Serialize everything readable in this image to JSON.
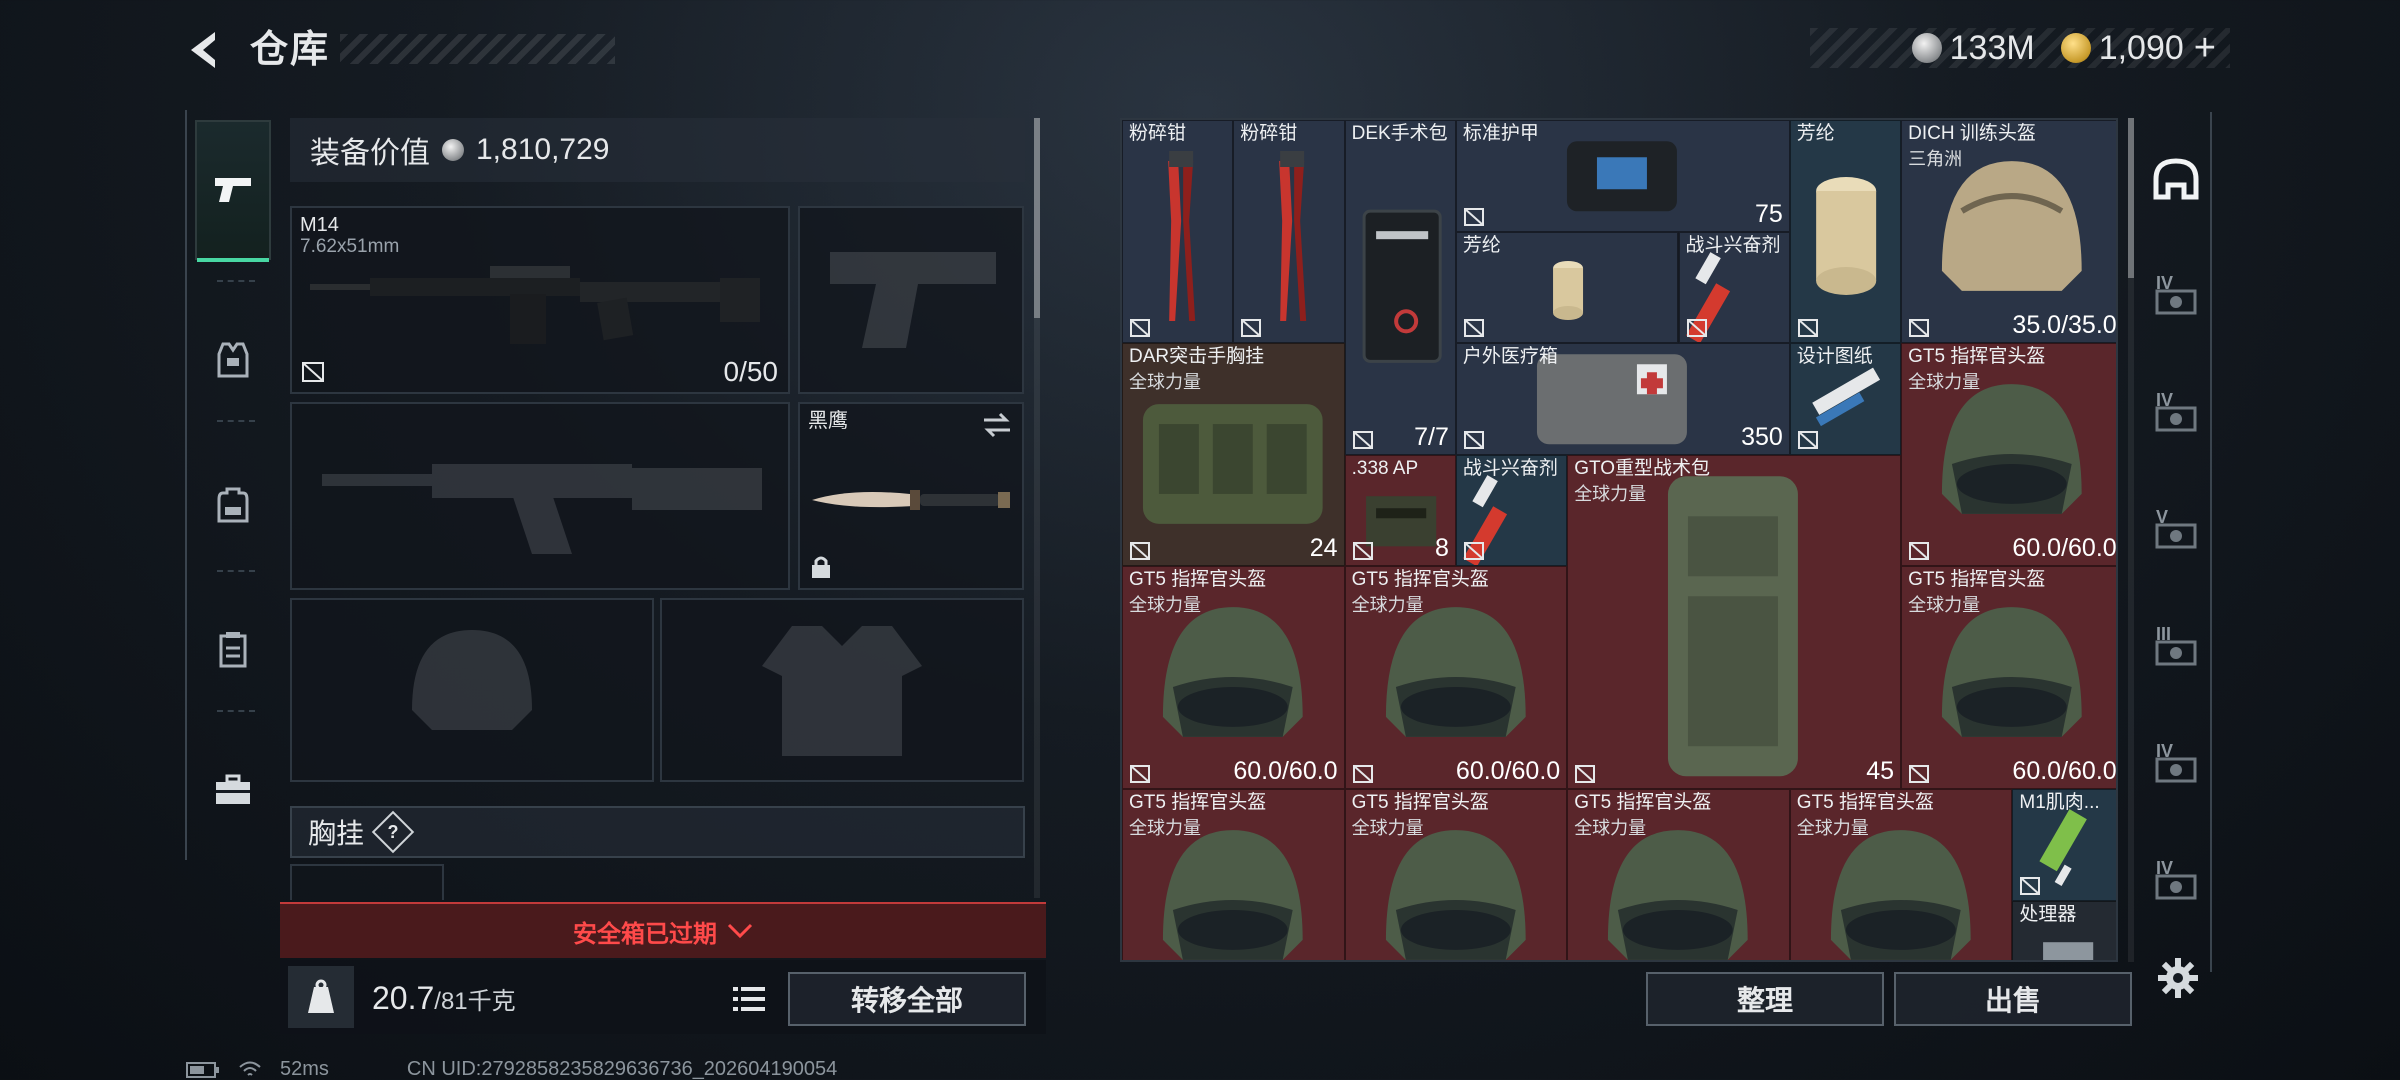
{
  "header": {
    "title": "仓库",
    "currency": [
      {
        "icon": "silver-coin-icon",
        "value": "133M"
      },
      {
        "icon": "gold-coin-icon",
        "value": "1,090"
      }
    ],
    "add_symbol": "+"
  },
  "left_rail": {
    "items": [
      {
        "icon": "pistol-icon",
        "active": true
      },
      {
        "icon": "vest-icon",
        "active": false
      },
      {
        "icon": "backpack-icon",
        "active": false
      },
      {
        "icon": "case-icon",
        "active": false
      },
      {
        "icon": "briefcase-icon",
        "active": false
      }
    ]
  },
  "equipment": {
    "value_label": "装备价值",
    "value": "1,810,729",
    "primary": {
      "name": "M14",
      "caliber": "7.62x51mm",
      "ammo": "0/50"
    },
    "melee": {
      "name": "黑鹰"
    },
    "chest_label": "胸挂",
    "chest_help": "?",
    "safebox_text": "安全箱已过期",
    "weight_current": "20.7",
    "weight_max": "/81千克",
    "transfer_all": "转移全部"
  },
  "inventory": {
    "items": [
      {
        "name": "粉碎钳",
        "sub": "",
        "value": "",
        "color": "blue",
        "art": "pliers"
      },
      {
        "name": "粉碎钳",
        "sub": "",
        "value": "",
        "color": "blue",
        "art": "pliers"
      },
      {
        "name": "DEK手术包",
        "sub": "",
        "value": "7/7",
        "color": "blue",
        "art": "surgical-kit"
      },
      {
        "name": "标准护甲",
        "sub": "",
        "value": "75",
        "color": "blue",
        "art": "armor-bag"
      },
      {
        "name": "芳纶",
        "sub": "",
        "value": "",
        "color": "teal",
        "art": "fabric-roll"
      },
      {
        "name": "DICH 训练头盔",
        "sub": "三角洲",
        "value": "35.0/35.0",
        "color": "blue",
        "art": "helmet-tan"
      },
      {
        "name": "芳纶",
        "sub": "",
        "value": "",
        "color": "blue",
        "art": "fabric-roll"
      },
      {
        "name": "战斗兴奋剂",
        "sub": "",
        "value": "",
        "color": "blue",
        "art": "syringe"
      },
      {
        "name": "DAR突击手胸挂",
        "sub": "全球力量",
        "value": "24",
        "color": "brown",
        "art": "chest-rig"
      },
      {
        "name": "户外医疗箱",
        "sub": "",
        "value": "350",
        "color": "blue",
        "art": "med-bag"
      },
      {
        "name": "设计图纸",
        "sub": "",
        "value": "",
        "color": "teal",
        "art": "blueprint"
      },
      {
        "name": "GT5 指挥官头盔",
        "sub": "全球力量",
        "value": "60.0/60.0",
        "color": "red",
        "art": "helmet-green"
      },
      {
        "name": ".338 AP",
        "sub": "",
        "value": "8",
        "color": "red",
        "art": "ammo-box"
      },
      {
        "name": "战斗兴奋剂",
        "sub": "",
        "value": "",
        "color": "teal",
        "art": "syringe"
      },
      {
        "name": "GTO重型战术包",
        "sub": "全球力量",
        "value": "45",
        "color": "red",
        "art": "backpack"
      },
      {
        "name": "GT5 指挥官头盔",
        "sub": "全球力量",
        "value": "60.0/60.0",
        "color": "red",
        "art": "helmet-green"
      },
      {
        "name": "GT5 指挥官头盔",
        "sub": "全球力量",
        "value": "60.0/60.0",
        "color": "red",
        "art": "helmet-green"
      },
      {
        "name": "GT5 指挥官头盔",
        "sub": "全球力量",
        "value": "60.0/60.0",
        "color": "red",
        "art": "helmet-green"
      },
      {
        "name": "GT5 指挥官头盔",
        "sub": "全球力量",
        "value": "",
        "color": "red",
        "art": "helmet-green"
      },
      {
        "name": "GT5 指挥官头盔",
        "sub": "全球力量",
        "value": "",
        "color": "red",
        "art": "helmet-green"
      },
      {
        "name": "GT5 指挥官头盔",
        "sub": "全球力量",
        "value": "",
        "color": "red",
        "art": "helmet-green"
      },
      {
        "name": "GT5 指挥官头盔",
        "sub": "全球力量",
        "value": "",
        "color": "red",
        "art": "helmet-green"
      },
      {
        "name": "M1肌肉...",
        "sub": "",
        "value": "",
        "color": "teal",
        "art": "injector"
      },
      {
        "name": "处理器",
        "sub": "",
        "value": "",
        "color": "dark",
        "art": "processor"
      }
    ],
    "sort_label": "整理",
    "sell_label": "出售"
  },
  "right_rail": {
    "items": [
      {
        "icon": "helmet-filter-icon",
        "tier": ""
      },
      {
        "icon": "tier-iv-item-icon",
        "tier": "IV"
      },
      {
        "icon": "tier-iv-item-icon",
        "tier": "IV"
      },
      {
        "icon": "tier-v-item-icon",
        "tier": "V"
      },
      {
        "icon": "tier-iii-item-icon",
        "tier": "III"
      },
      {
        "icon": "tier-iv-item-icon",
        "tier": "IV"
      },
      {
        "icon": "tier-iv-item-icon",
        "tier": "IV"
      }
    ]
  },
  "footer": {
    "ping": "52ms",
    "uid": "CN UID:2792858235829636736_202604190054"
  },
  "colors": {
    "accent": "#48d7a3",
    "alert": "#ff4a4a",
    "rarity_red": "#5a262b",
    "rarity_blue": "#2a3446",
    "rarity_brown": "#3e302a"
  }
}
